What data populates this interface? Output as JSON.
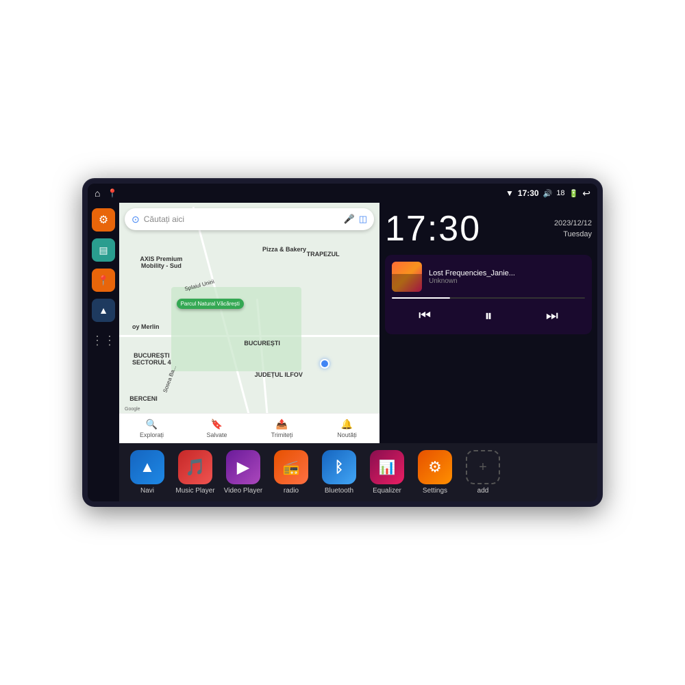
{
  "device": {
    "status_bar": {
      "left_icons": [
        "home",
        "location"
      ],
      "wifi_icon": "▼",
      "time": "17:30",
      "volume_icon": "🔊",
      "battery": "18",
      "battery_icon": "🔋",
      "back_icon": "↩"
    },
    "sidebar": {
      "items": [
        {
          "name": "settings",
          "icon": "⚙",
          "style": "orange"
        },
        {
          "name": "files",
          "icon": "📁",
          "style": "teal"
        },
        {
          "name": "navigation",
          "icon": "📍",
          "style": "orange"
        },
        {
          "name": "arrow",
          "icon": "▲",
          "style": "nav"
        },
        {
          "name": "grid",
          "icon": "⋮⋮⋮",
          "style": "grid"
        }
      ]
    },
    "map": {
      "search_placeholder": "Căutați aici",
      "places": [
        "AXIS Premium Mobility - Sud",
        "Parcul Natural Văcărești",
        "Pizza & Bakery",
        "TRAPEZUL",
        "oy Merlin",
        "BUCUREȘTI SECTORUL 4",
        "BERCENI",
        "BUCUREȘTI",
        "JUDEȚUL ILFOV"
      ],
      "tabs": [
        "Explorați",
        "Salvate",
        "Trimiteți",
        "Noutăți"
      ],
      "copyright": "Google"
    },
    "clock": {
      "time": "17:30",
      "date": "2023/12/12",
      "day": "Tuesday"
    },
    "music": {
      "title": "Lost Frequencies_Janie...",
      "artist": "Unknown",
      "progress": 30
    },
    "apps": [
      {
        "label": "Navi",
        "icon": "navi",
        "icon_char": "▲"
      },
      {
        "label": "Music Player",
        "icon": "music",
        "icon_char": "🎵"
      },
      {
        "label": "Video Player",
        "icon": "video",
        "icon_char": "▶"
      },
      {
        "label": "radio",
        "icon": "radio",
        "icon_char": "📻"
      },
      {
        "label": "Bluetooth",
        "icon": "bluetooth",
        "icon_char": "Ⓑ"
      },
      {
        "label": "Equalizer",
        "icon": "equalizer",
        "icon_char": "📊"
      },
      {
        "label": "Settings",
        "icon": "settings",
        "icon_char": "⚙"
      },
      {
        "label": "add",
        "icon": "add",
        "icon_char": "+"
      }
    ]
  }
}
